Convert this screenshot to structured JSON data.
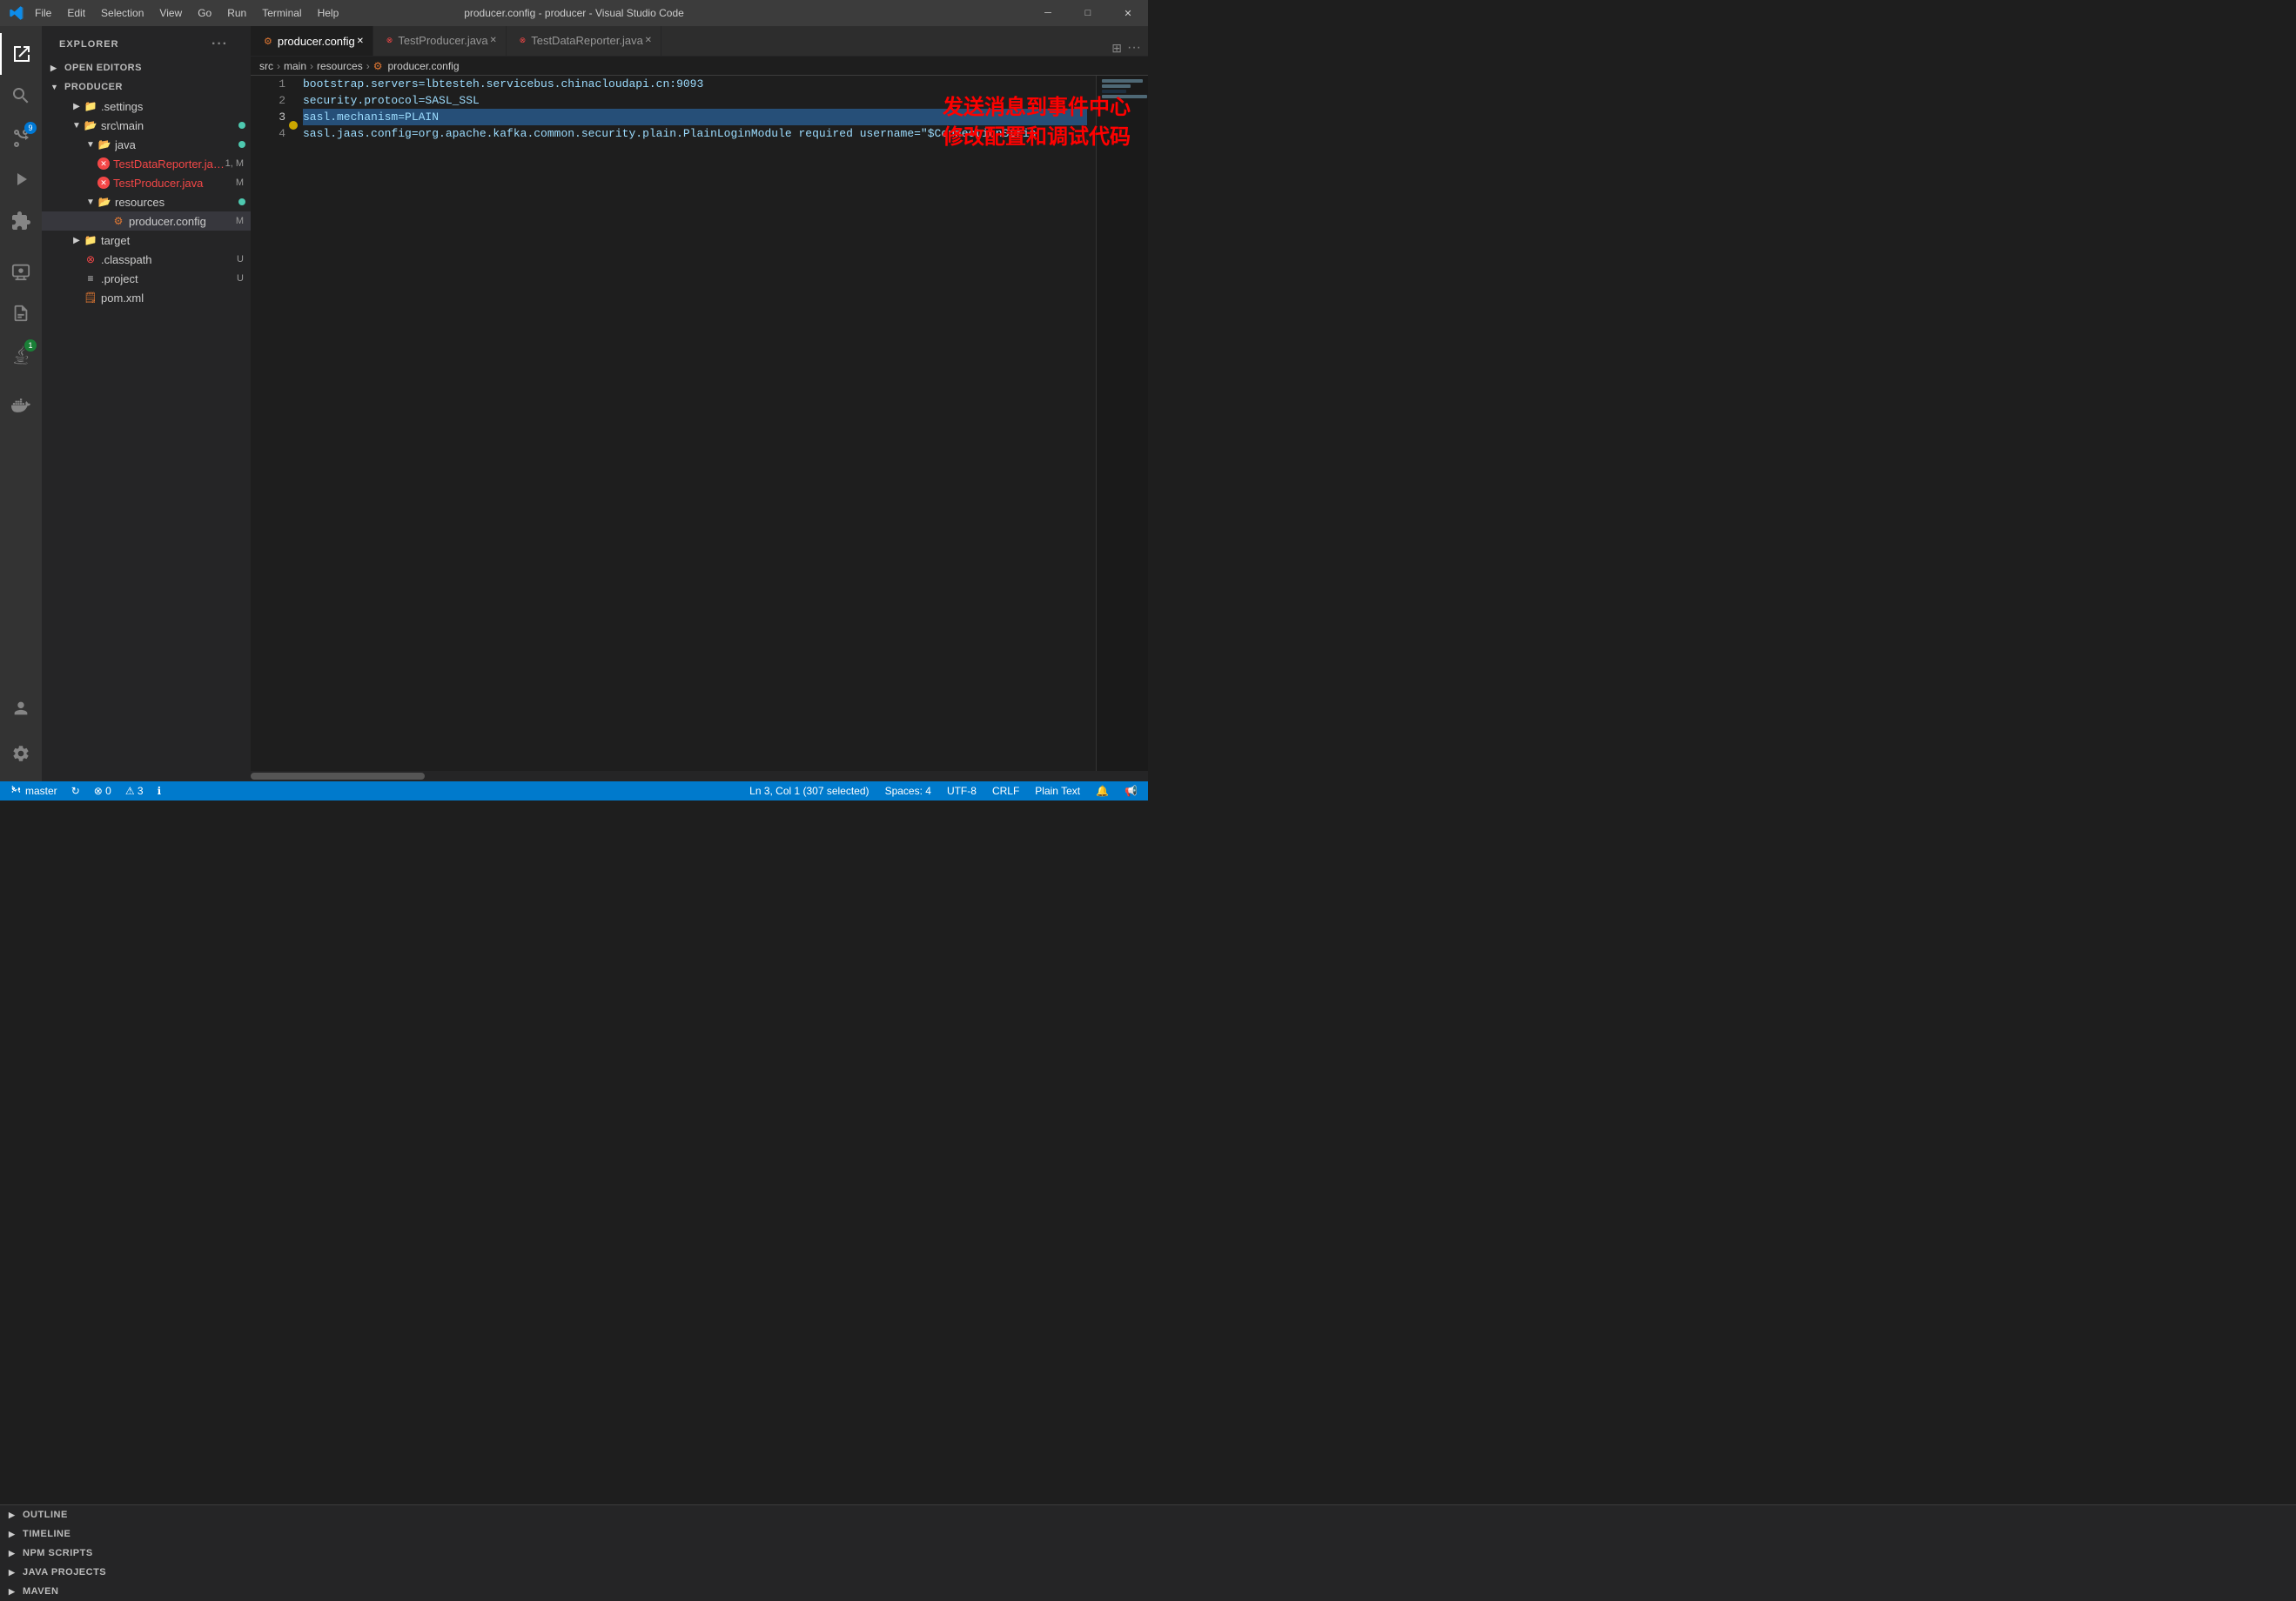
{
  "titlebar": {
    "title": "producer.config - producer - Visual Studio Code",
    "menu": [
      "File",
      "Edit",
      "Selection",
      "View",
      "Go",
      "Run",
      "Terminal",
      "Help"
    ],
    "controls": [
      "─",
      "□",
      "✕"
    ]
  },
  "activitybar": {
    "icons": [
      {
        "name": "explorer",
        "symbol": "⎘",
        "active": true
      },
      {
        "name": "search",
        "symbol": "🔍"
      },
      {
        "name": "source-control",
        "symbol": "⑂",
        "badge": "9"
      },
      {
        "name": "run-debug",
        "symbol": "▷"
      },
      {
        "name": "extensions",
        "symbol": "⊞"
      },
      {
        "name": "remote-explorer",
        "symbol": "⊡"
      },
      {
        "name": "test",
        "symbol": "⚗"
      },
      {
        "name": "java-projects",
        "symbol": "☕"
      },
      {
        "name": "docker",
        "symbol": "🐳"
      }
    ],
    "bottom": [
      {
        "name": "accounts",
        "symbol": "👤"
      },
      {
        "name": "settings",
        "symbol": "⚙"
      }
    ]
  },
  "sidebar": {
    "header": "Explorer",
    "sections": {
      "openEditors": {
        "label": "OPEN EDITORS",
        "collapsed": false
      },
      "producer": {
        "label": "PRODUCER",
        "expanded": true,
        "items": [
          {
            "name": ".settings",
            "type": "folder",
            "indent": 1,
            "collapsed": true
          },
          {
            "name": "src\\main",
            "type": "folder",
            "indent": 1,
            "expanded": true
          },
          {
            "name": "java",
            "type": "folder",
            "indent": 2,
            "expanded": true
          },
          {
            "name": "TestDataReporter.java",
            "type": "java-error",
            "indent": 3,
            "badge": "1, M"
          },
          {
            "name": "TestProducer.java",
            "type": "java-error",
            "indent": 3,
            "badge": "M"
          },
          {
            "name": "resources",
            "type": "folder",
            "indent": 2,
            "expanded": true,
            "dot": "modified"
          },
          {
            "name": "producer.config",
            "type": "config",
            "indent": 3,
            "badge": "M",
            "selected": true
          },
          {
            "name": "target",
            "type": "folder",
            "indent": 1,
            "collapsed": true
          },
          {
            "name": ".classpath",
            "type": "classpath",
            "indent": 1,
            "badge": "U"
          },
          {
            "name": ".project",
            "type": "project",
            "indent": 1,
            "badge": "U"
          },
          {
            "name": "pom.xml",
            "type": "xml",
            "indent": 1
          }
        ]
      }
    },
    "bottomSections": [
      {
        "label": "OUTLINE",
        "collapsed": true
      },
      {
        "label": "TIMELINE",
        "collapsed": true
      },
      {
        "label": "NPM SCRIPTS",
        "collapsed": true
      },
      {
        "label": "JAVA PROJECTS",
        "collapsed": true
      },
      {
        "label": "MAVEN",
        "collapsed": true
      }
    ]
  },
  "tabs": [
    {
      "label": "producer.config",
      "icon": "⚙",
      "active": true,
      "modified": false
    },
    {
      "label": "TestProducer.java",
      "icon": "☕",
      "active": false,
      "error": true
    },
    {
      "label": "TestDataReporter.java",
      "icon": "☕",
      "active": false,
      "error": true
    }
  ],
  "breadcrumb": {
    "parts": [
      "src",
      "main",
      "resources",
      "producer.config"
    ]
  },
  "editor": {
    "lines": [
      {
        "num": 1,
        "content": "bootstrap.servers=lbtesteh.servicebus.chinacloudapi.cn:9093"
      },
      {
        "num": 2,
        "content": "security.protocol=SASL_SSL"
      },
      {
        "num": 3,
        "content": "sasl.mechanism=PLAIN",
        "selected": true
      },
      {
        "num": 4,
        "content": "sasl.jaas.config=org.apache.kafka.common.security.plain.PlainLoginModule required username=\"$ConnectionStrin"
      }
    ]
  },
  "annotation": {
    "line1": "发送消息到事件中心",
    "line2": "修改配置和调试代码"
  },
  "statusbar": {
    "branch": "master",
    "sync": "↻",
    "errors": "⊗ 0",
    "warnings": "⚠ 3",
    "info": "ℹ",
    "position": "Ln 3, Col 1 (307 selected)",
    "spaces": "Spaces: 4",
    "encoding": "UTF-8",
    "lineending": "CRLF",
    "language": "Plain Text",
    "notifications": "🔔",
    "broadcast": "📢"
  }
}
